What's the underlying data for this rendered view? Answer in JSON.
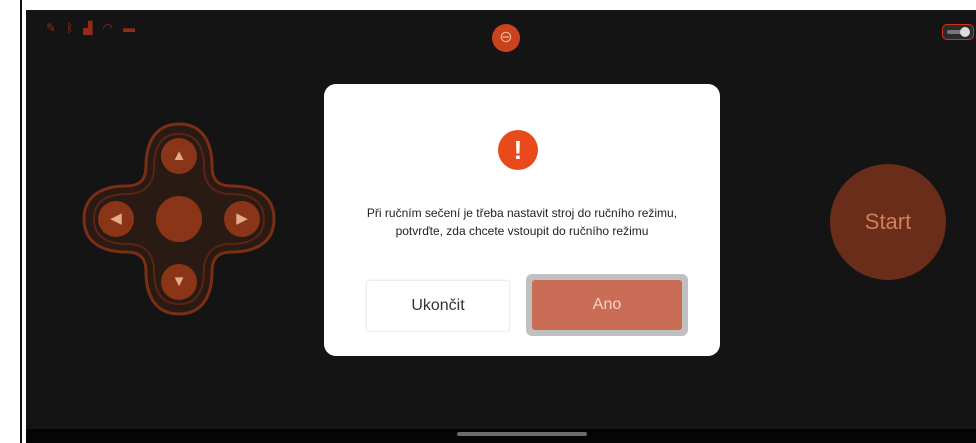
{
  "status_bar": {
    "icons": [
      "pencil-icon",
      "bluetooth-icon",
      "signal-icon",
      "wifi-icon",
      "battery-icon"
    ],
    "icon_glyphs": [
      "✎",
      "ᛒ",
      "▟",
      "◠",
      "▬"
    ],
    "logo_glyph": "⊖",
    "toggle_state": "on"
  },
  "dpad": {
    "up": "▲",
    "down": "▼",
    "left": "◀",
    "right": "▶"
  },
  "start": {
    "label": "Start"
  },
  "dialog": {
    "icon_glyph": "!",
    "message": "Při ručním sečení je třeba nastavit stroj do ručního režimu, potvrďte, zda chcete vstoupit do ručního režimu",
    "cancel_label": "Ukončit",
    "confirm_label": "Ano"
  },
  "colors": {
    "background": "#141414",
    "accent": "#e84a1c",
    "confirm_button": "#c96d56",
    "dpad": "#8a3418"
  }
}
